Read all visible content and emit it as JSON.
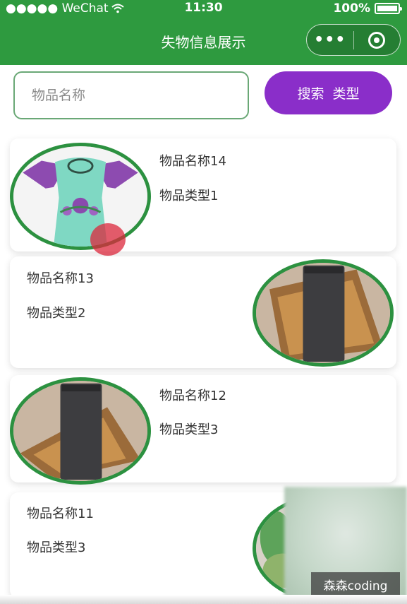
{
  "status_bar": {
    "signal": "●●●●● WeChat",
    "time": "11:30",
    "battery": "100%"
  },
  "nav": {
    "title": "失物信息展示",
    "more_icon_text": "•••"
  },
  "search": {
    "placeholder": "物品名称",
    "button_label_1": "搜索",
    "button_label_2": "类型"
  },
  "items": [
    {
      "name": "物品名称14",
      "type": "物品类型1",
      "image": "embroidered-dress"
    },
    {
      "name": "物品名称13",
      "type": "物品类型2",
      "image": "wallet-box"
    },
    {
      "name": "物品名称12",
      "type": "物品类型3",
      "image": "wallet-box"
    },
    {
      "name": "物品名称11",
      "type": "物品类型3",
      "image": "plant"
    }
  ],
  "watermark": "森森coding",
  "colors": {
    "nav_green": "#2e9a3f",
    "accent_purple": "#8a2ec9",
    "thumb_border_green": "#2c9140"
  }
}
